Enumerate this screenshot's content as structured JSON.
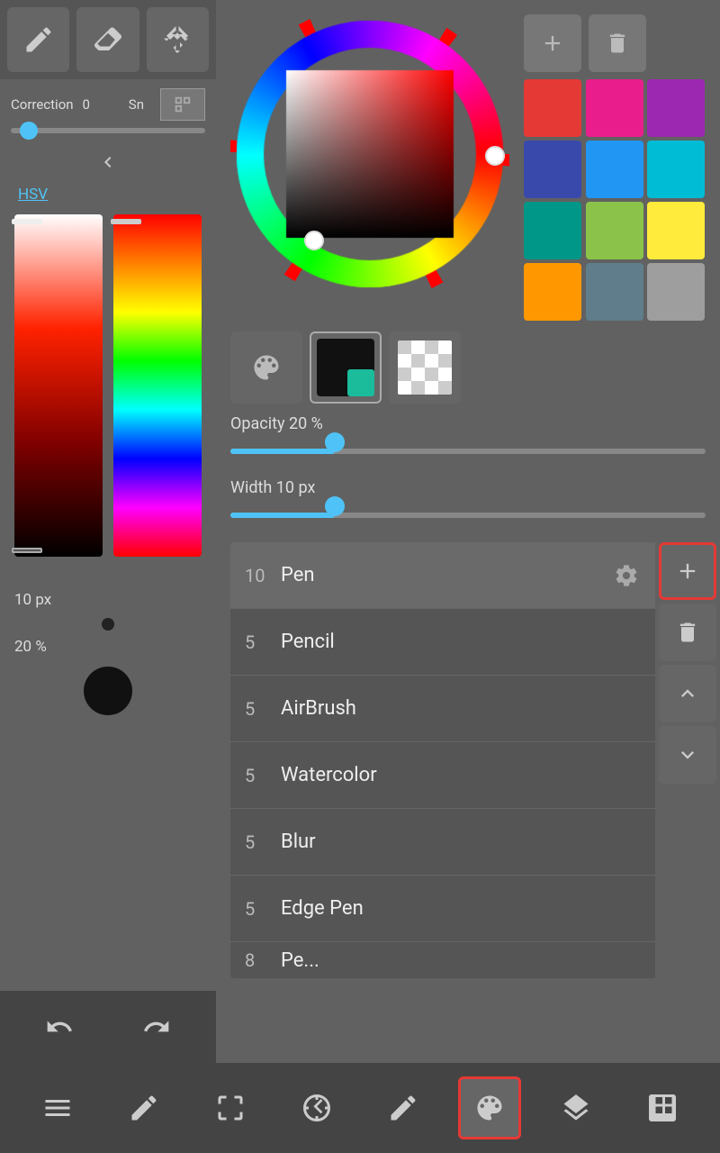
{
  "toolbar": {
    "pen_label": "Pen tool",
    "eraser_label": "Eraser tool",
    "move_label": "Move tool",
    "correction_label": "Correction",
    "correction_value": "0",
    "snap_label": "Sn"
  },
  "hsv": {
    "label": "HSV"
  },
  "size": {
    "label": "10 px",
    "opacity_label": "20 %"
  },
  "color_picker": {
    "opacity_label": "Opacity 20 %",
    "opacity_value": 20,
    "width_label": "Width 10 px",
    "width_value": 10,
    "opacity_thumb_pct": 22,
    "width_thumb_pct": 22
  },
  "swatches": [
    {
      "color": "#e53935"
    },
    {
      "color": "#e91e8c"
    },
    {
      "color": "#9c27b0"
    },
    {
      "color": "#3949ab"
    },
    {
      "color": "#2196f3"
    },
    {
      "color": "#00bcd4"
    },
    {
      "color": "#009688"
    },
    {
      "color": "#8bc34a"
    },
    {
      "color": "#ffeb3b"
    },
    {
      "color": "#ff9800"
    },
    {
      "color": "#607d8b"
    },
    {
      "color": "#9e9e9e"
    }
  ],
  "brush_list": [
    {
      "num": "10",
      "name": "Pen",
      "has_settings": true,
      "active": true
    },
    {
      "num": "5",
      "name": "Pencil",
      "has_settings": false,
      "active": false
    },
    {
      "num": "5",
      "name": "AirBrush",
      "has_settings": false,
      "active": false
    },
    {
      "num": "5",
      "name": "Watercolor",
      "has_settings": false,
      "active": false
    },
    {
      "num": "5",
      "name": "Blur",
      "has_settings": false,
      "active": false
    },
    {
      "num": "5",
      "name": "Edge Pen",
      "has_settings": false,
      "active": false
    },
    {
      "num": "8",
      "name": "Pe...",
      "has_settings": false,
      "active": false
    }
  ],
  "bottom_bar": {
    "menu_label": "Menu",
    "edit_label": "Edit",
    "select_label": "Select",
    "transform_label": "Transform",
    "pen_label": "Pen",
    "color_label": "Color",
    "layers_label": "Layers",
    "grid_label": "Grid"
  }
}
